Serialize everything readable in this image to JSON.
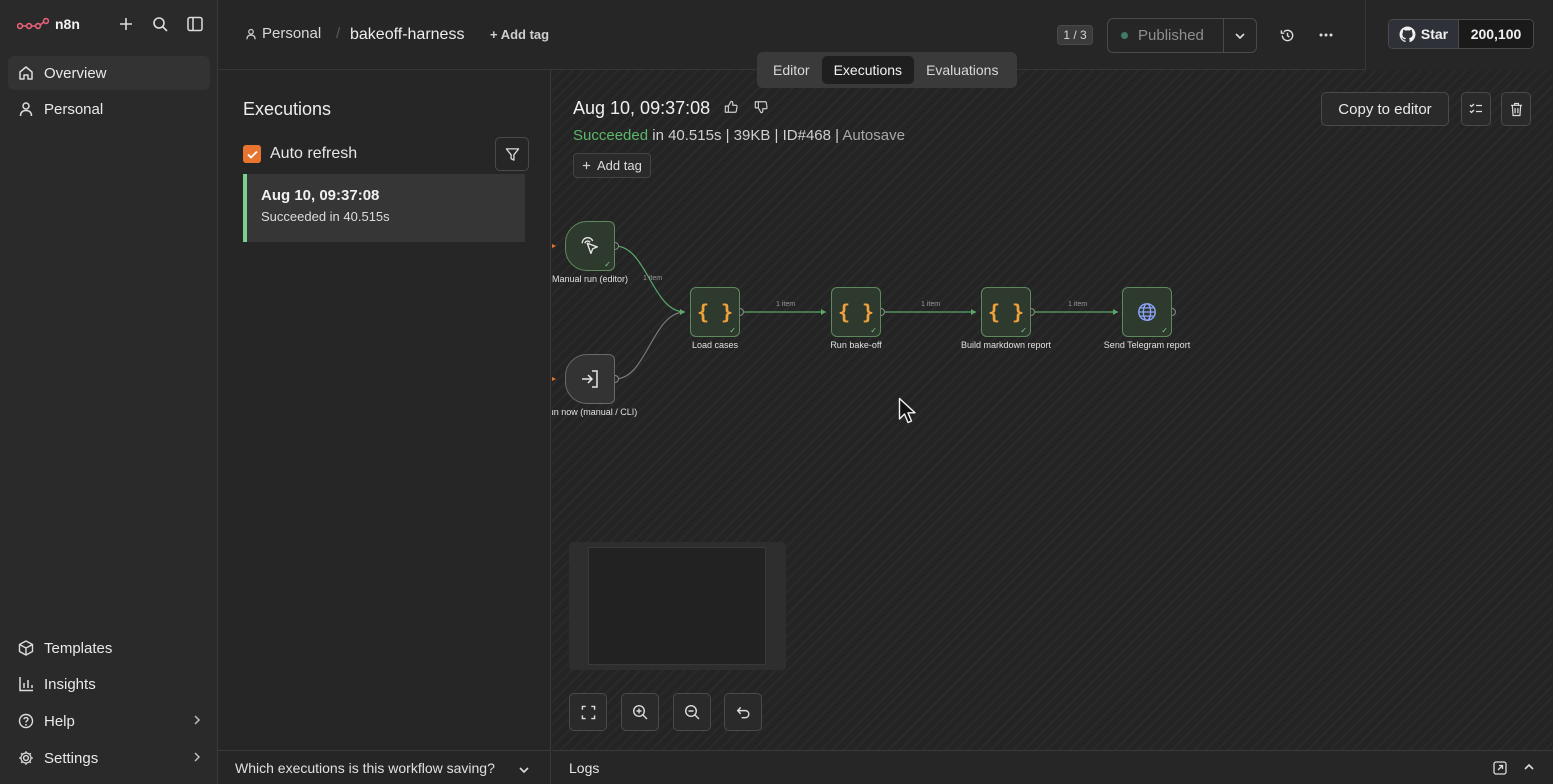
{
  "brand": {
    "name": "n8n",
    "accent": "#e8742f"
  },
  "sidebar": {
    "top_items": [
      {
        "label": "Overview",
        "icon": "home-icon"
      },
      {
        "label": "Personal",
        "icon": "user-icon"
      }
    ],
    "bottom_items": [
      {
        "label": "Templates",
        "icon": "box-icon"
      },
      {
        "label": "Insights",
        "icon": "bar-chart-icon"
      },
      {
        "label": "Help",
        "icon": "help-circle-icon"
      },
      {
        "label": "Settings",
        "icon": "gear-icon"
      }
    ]
  },
  "header": {
    "project": "Personal",
    "workflow": "bakeoff-harness",
    "add_tag": "+ Add tag",
    "counter": "1 / 3",
    "publish_status": "Published",
    "github": {
      "star": "Star",
      "count": "200,100"
    }
  },
  "tabs": [
    {
      "label": "Editor",
      "active": false
    },
    {
      "label": "Executions",
      "active": true
    },
    {
      "label": "Evaluations",
      "active": false
    }
  ],
  "executions": {
    "title": "Executions",
    "auto_refresh": "Auto refresh",
    "items": [
      {
        "time": "Aug 10, 09:37:08",
        "status": "Succeeded in 40.515s"
      }
    ],
    "saving_question": "Which executions is this workflow saving?"
  },
  "detail": {
    "time": "Aug 10, 09:37:08",
    "status": "Succeeded",
    "meta": " in 40.515s | 39KB | ID#468 | ",
    "mode": "Autosave",
    "add_tag": "Add tag",
    "copy_to_editor": "Copy to editor"
  },
  "workflow": {
    "nodes": [
      {
        "label": "Manual run (editor)",
        "icon": "pointer-click-icon"
      },
      {
        "label": "un now (manual / CLI)",
        "icon": "sign-in-icon"
      },
      {
        "label": "Load cases",
        "icon": "braces-icon"
      },
      {
        "label": "Run bake-off",
        "icon": "braces-icon"
      },
      {
        "label": "Build markdown report",
        "icon": "braces-icon"
      },
      {
        "label": "Send Telegram report",
        "icon": "globe-icon"
      }
    ],
    "edge_labels": [
      "1 item",
      "1 item",
      "1 item",
      "1 item"
    ]
  },
  "logs": {
    "label": "Logs"
  }
}
